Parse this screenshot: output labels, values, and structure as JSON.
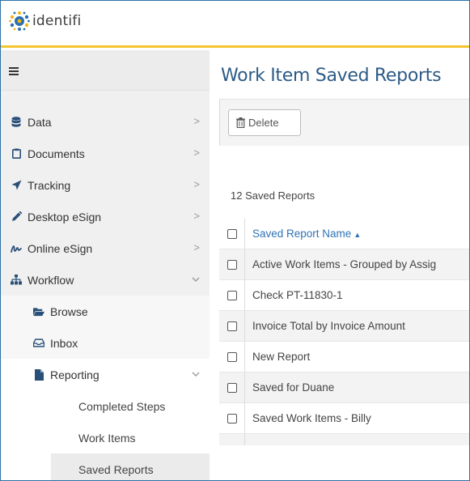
{
  "app": {
    "name": "identifi"
  },
  "sidebar": {
    "items": [
      {
        "label": "Data",
        "icon": "database-icon"
      },
      {
        "label": "Documents",
        "icon": "clipboard-icon"
      },
      {
        "label": "Tracking",
        "icon": "paper-plane-icon"
      },
      {
        "label": "Desktop eSign",
        "icon": "pen-icon"
      },
      {
        "label": "Online eSign",
        "icon": "signature-icon"
      },
      {
        "label": "Workflow",
        "icon": "sitemap-icon"
      }
    ],
    "workflow_children": [
      {
        "label": "Browse",
        "icon": "folder-open-icon"
      },
      {
        "label": "Inbox",
        "icon": "inbox-icon"
      },
      {
        "label": "Reporting",
        "icon": "file-icon"
      }
    ],
    "reporting_children": [
      {
        "label": "Completed Steps"
      },
      {
        "label": "Work Items"
      },
      {
        "label": "Saved Reports"
      }
    ]
  },
  "main": {
    "title": "Work Item Saved Reports",
    "toolbar": {
      "delete_label": "Delete"
    },
    "count_label": "12 Saved Reports",
    "table": {
      "header": "Saved Report Name",
      "rows": [
        "Active Work Items - Grouped by Assig",
        "Check PT-11830-1",
        "Invoice Total by Invoice Amount",
        "New Report",
        "Saved for Duane",
        "Saved Work Items - Billy"
      ]
    }
  },
  "colors": {
    "accent": "#f2c52e",
    "title": "#2d5b86",
    "link": "#2f73b5"
  }
}
